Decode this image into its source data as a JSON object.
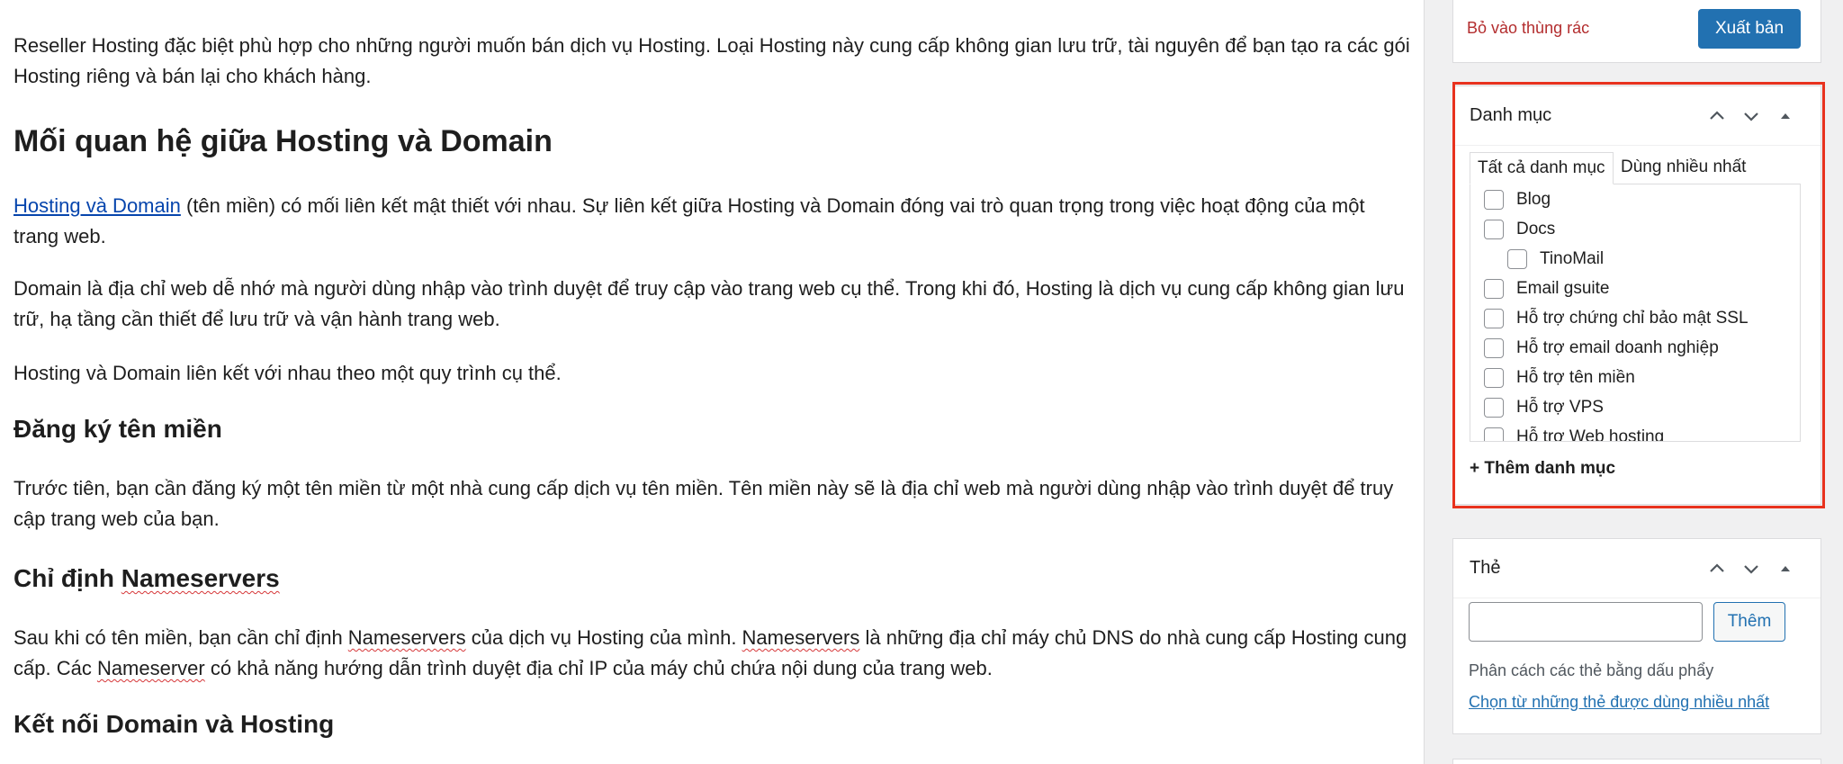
{
  "editor": {
    "p1": "Reseller Hosting đặc biệt phù hợp cho những người muốn bán dịch vụ Hosting. Loại Hosting này cung cấp không gian lưu trữ, tài nguyên để bạn tạo ra các gói Hosting riêng và bán lại cho khách hàng.",
    "h_relation": "Mối quan hệ giữa Hosting và Domain",
    "p2_link": "Hosting và Domain",
    "p2_rest": " (tên miền) có mối liên kết mật thiết với nhau. Sự liên kết giữa Hosting và Domain đóng vai trò quan trọng trong việc hoạt động của một trang web.",
    "p3": "Domain là địa chỉ web dễ nhớ mà người dùng nhập vào trình duyệt để truy cập vào trang web cụ thể. Trong khi đó, Hosting là dịch vụ cung cấp không gian lưu trữ, hạ tầng cần thiết để lưu trữ và vận hành trang web.",
    "p4": "Hosting và Domain liên kết với nhau theo một quy trình cụ thể.",
    "h_register": "Đăng ký tên miền",
    "p5": "Trước tiên, bạn cần đăng ký một tên miền từ một nhà cung cấp dịch vụ tên miền. Tên miền này sẽ là địa chỉ web mà người dùng nhập vào trình duyệt để truy cập trang web của bạn.",
    "h_ns_prefix": "Chỉ định ",
    "h_ns_word": "Nameservers",
    "p6_a": "Sau khi có tên miền, bạn cần chỉ định ",
    "p6_ns1": "Nameservers",
    "p6_b": " của dịch vụ Hosting của mình. ",
    "p6_ns2": "Nameservers",
    "p6_c": " là những địa chỉ máy chủ DNS do nhà cung cấp Hosting cung cấp. Các ",
    "p6_ns3": "Nameserver",
    "p6_d": " có khả năng hướng dẫn trình duyệt địa chỉ IP của máy chủ chứa nội dung của trang web.",
    "h_connect": "Kết nối Domain và Hosting"
  },
  "publish": {
    "trash_label": "Bỏ vào thùng rác",
    "publish_label": "Xuất bản"
  },
  "categories": {
    "title": "Danh mục",
    "tab_all": "Tất cả danh mục",
    "tab_popular": "Dùng nhiều nhất",
    "items": [
      "Blog",
      "Docs",
      "TinoMail",
      "Email gsuite",
      "Hỗ trợ chứng chỉ bảo mật SSL",
      "Hỗ trợ email doanh nghiệp",
      "Hỗ trợ tên miền",
      "Hỗ trợ VPS",
      "Hỗ trợ Web hosting"
    ],
    "add_label": "+ Thêm danh mục"
  },
  "tags": {
    "title": "Thẻ",
    "input_value": "",
    "add_label": "Thêm",
    "hint": "Phân cách các thẻ bằng dấu phẩy",
    "popular_link": "Chọn từ những thẻ được dùng nhiều nhất"
  },
  "colors": {
    "primary": "#2271b1",
    "danger": "#b32d2e",
    "highlight": "#e8321e",
    "link": "#0645ad"
  }
}
